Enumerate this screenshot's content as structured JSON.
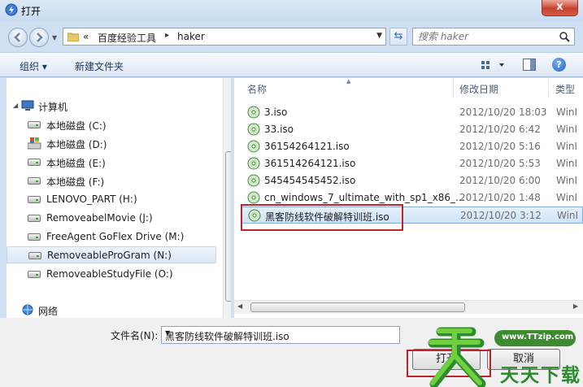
{
  "window": {
    "title": "打开",
    "close": "x"
  },
  "address": {
    "prefix": "«",
    "segments": [
      "百度经验工具",
      "haker"
    ]
  },
  "search": {
    "placeholder": "搜索 haker"
  },
  "toolbar": {
    "organize": "组织 ▾",
    "new_folder": "新建文件夹"
  },
  "nav": {
    "computer": "计算机",
    "drives": [
      {
        "label": "本地磁盘 (C:)"
      },
      {
        "label": "本地磁盘 (D:)"
      },
      {
        "label": "本地磁盘 (E:)"
      },
      {
        "label": "本地磁盘 (F:)"
      },
      {
        "label": "LENOVO_PART (H:)"
      },
      {
        "label": "RemoveabelMovie (J:)"
      },
      {
        "label": "FreeAgent GoFlex Drive (M:)"
      },
      {
        "label": "RemoveableProGram (N:)"
      },
      {
        "label": "RemoveableStudyFile (O:)"
      }
    ],
    "network": "网络"
  },
  "columns": {
    "name": "名称",
    "date": "修改日期",
    "type": "类型"
  },
  "files": [
    {
      "name": "3.iso",
      "date": "2012/10/20 18:03",
      "type": "WinI"
    },
    {
      "name": "33.iso",
      "date": "2012/10/20 6:42",
      "type": "WinI"
    },
    {
      "name": "36154264121.iso",
      "date": "2012/10/20 5:16",
      "type": "WinI"
    },
    {
      "name": "361514264121.iso",
      "date": "2012/10/20 5:53",
      "type": "WinI"
    },
    {
      "name": "545454545452.iso",
      "date": "2012/10/20 6:00",
      "type": "WinI"
    },
    {
      "name": "cn_windows_7_ultimate_with_sp1_x86_...",
      "date": "2012/10/20 1:48",
      "type": "WinI"
    },
    {
      "name": "黑客防线软件破解特训班.iso",
      "date": "2012/10/20 3:12",
      "type": "WinI"
    }
  ],
  "filename": {
    "label": "文件名(N):",
    "value": "黑客防线软件破解特训班.iso"
  },
  "buttons": {
    "open": "打开",
    "cancel": "取消"
  },
  "watermark": {
    "url": "www.TTzip.com",
    "text": "天天下载"
  }
}
